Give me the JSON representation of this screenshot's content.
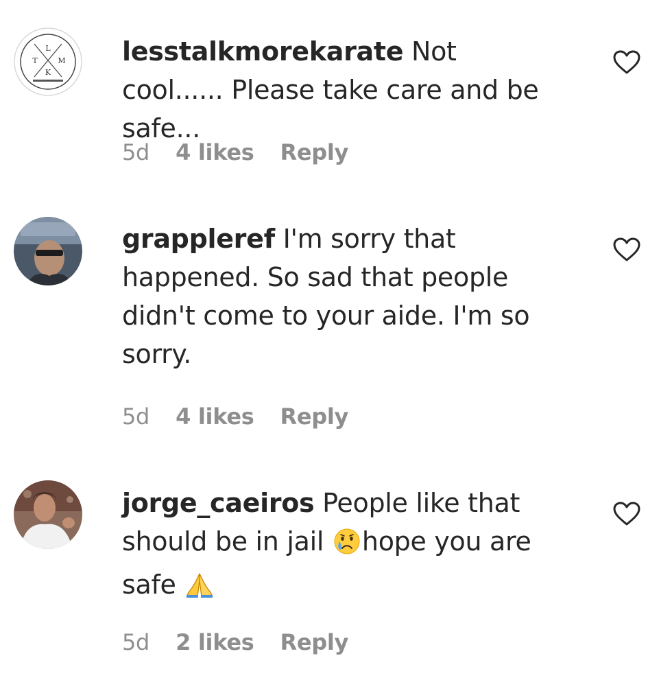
{
  "comments": [
    {
      "username": "lesstalkmorekarate",
      "text": "Not cool...... Please take care and be safe...",
      "time": "5d",
      "likes": "4 likes",
      "reply": "Reply",
      "avatar_letters": [
        "L",
        "T",
        "M",
        "K"
      ]
    },
    {
      "username": "grappleref",
      "text": "I'm sorry that happened. So sad that people didn't come to your aide. I'm so sorry.",
      "time": "5d",
      "likes": "4 likes",
      "reply": "Reply"
    },
    {
      "username": "jorge_caeiros",
      "text_part1": "People like that should be in jail",
      "text_part2": "hope you are safe",
      "emoji1": "crying-face",
      "emoji2": "folded-hands",
      "time": "5d",
      "likes": "2 likes",
      "reply": "Reply"
    }
  ],
  "icons": {
    "like": "heart-outline-icon"
  },
  "colors": {
    "text": "#262626",
    "meta": "#8e8e8e"
  }
}
